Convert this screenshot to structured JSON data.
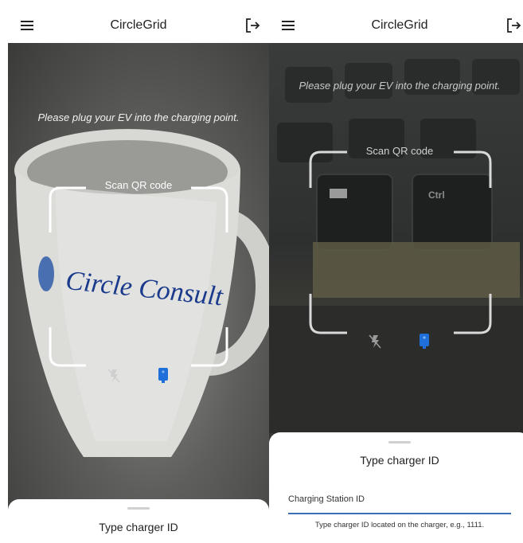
{
  "app": {
    "title": "CircleGrid",
    "menu_icon": "hamburger-menu-icon",
    "logout_icon": "logout-icon"
  },
  "scanner": {
    "instruction": "Please plug your EV into the charging point.",
    "scan_label": "Scan QR code",
    "flash_icon": "flash-off-icon",
    "torch_icon": "phone-torch-icon",
    "accent_color": "#1e6fd9"
  },
  "left_mug_text": "Circle Consult",
  "right_keyboard_key": "Ctrl",
  "sheet": {
    "title": "Type charger ID",
    "field_label": "Charging Station ID",
    "helper_text": "Type charger ID located on the charger, e.g., 1111."
  }
}
